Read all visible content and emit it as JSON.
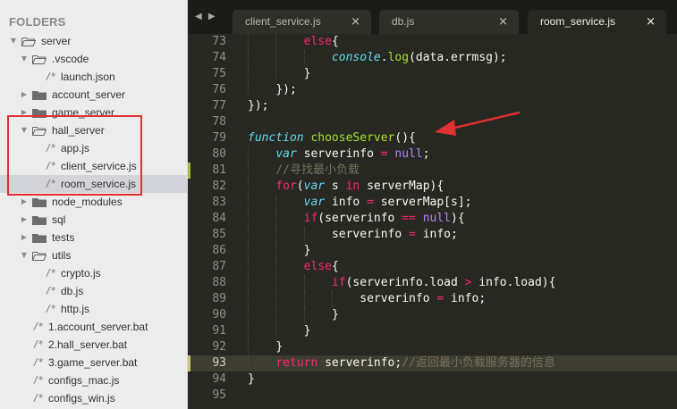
{
  "sidebar": {
    "header": "FOLDERS",
    "items": [
      {
        "label": "server",
        "kind": "folder",
        "open": true,
        "depth": 0
      },
      {
        "label": ".vscode",
        "kind": "folder",
        "open": true,
        "depth": 1
      },
      {
        "label": "launch.json",
        "kind": "file",
        "depth": 2
      },
      {
        "label": "account_server",
        "kind": "folder",
        "open": false,
        "depth": 1
      },
      {
        "label": "game_server",
        "kind": "folder",
        "open": false,
        "depth": 1
      },
      {
        "label": "hall_server",
        "kind": "folder",
        "open": true,
        "depth": 1
      },
      {
        "label": "app.js",
        "kind": "file",
        "depth": 2
      },
      {
        "label": "client_service.js",
        "kind": "file",
        "depth": 2
      },
      {
        "label": "room_service.js",
        "kind": "file",
        "depth": 2,
        "selected": true
      },
      {
        "label": "node_modules",
        "kind": "folder",
        "open": false,
        "depth": 1
      },
      {
        "label": "sql",
        "kind": "folder",
        "open": false,
        "depth": 1
      },
      {
        "label": "tests",
        "kind": "folder",
        "open": false,
        "depth": 1
      },
      {
        "label": "utils",
        "kind": "folder",
        "open": true,
        "depth": 1
      },
      {
        "label": "crypto.js",
        "kind": "file",
        "depth": 2
      },
      {
        "label": "db.js",
        "kind": "file",
        "depth": 2
      },
      {
        "label": "http.js",
        "kind": "file",
        "depth": 2
      },
      {
        "label": "1.account_server.bat",
        "kind": "file",
        "depth": 1
      },
      {
        "label": "2.hall_server.bat",
        "kind": "file",
        "depth": 1
      },
      {
        "label": "3.game_server.bat",
        "kind": "file",
        "depth": 1
      },
      {
        "label": "configs_mac.js",
        "kind": "file",
        "depth": 1
      },
      {
        "label": "configs_win.js",
        "kind": "file",
        "depth": 1
      }
    ],
    "file_glyph": "/*"
  },
  "tabbar": {
    "nav_glyph": "◀ ▶",
    "tabs": [
      {
        "label": "client_service.js",
        "active": false
      },
      {
        "label": "db.js",
        "active": false
      },
      {
        "label": "room_service.js",
        "active": true
      }
    ],
    "close_glyph": "×"
  },
  "editor": {
    "lines": [
      {
        "n": "73",
        "indent": 2,
        "tokens": [
          [
            "kw",
            "else"
          ],
          [
            "pl",
            "{"
          ]
        ]
      },
      {
        "n": "74",
        "indent": 3,
        "tokens": [
          [
            "st",
            "console"
          ],
          [
            "pl",
            "."
          ],
          [
            "fn",
            "log"
          ],
          [
            "pl",
            "(data.errmsg);"
          ]
        ]
      },
      {
        "n": "75",
        "indent": 2,
        "tokens": [
          [
            "pl",
            "}"
          ]
        ]
      },
      {
        "n": "76",
        "indent": 1,
        "tokens": [
          [
            "pl",
            "});"
          ]
        ]
      },
      {
        "n": "77",
        "indent": 0,
        "tokens": [
          [
            "pl",
            "});"
          ]
        ]
      },
      {
        "n": "78",
        "indent": 0,
        "tokens": []
      },
      {
        "n": "79",
        "indent": 0,
        "tokens": [
          [
            "st",
            "function"
          ],
          [
            "pl",
            " "
          ],
          [
            "fn",
            "chooseServer"
          ],
          [
            "pl",
            "(){"
          ]
        ]
      },
      {
        "n": "80",
        "indent": 1,
        "tokens": [
          [
            "st",
            "var"
          ],
          [
            "pl",
            " serverinfo "
          ],
          [
            "kw",
            "="
          ],
          [
            "pl",
            " "
          ],
          [
            "num",
            "null"
          ],
          [
            "pl",
            ";"
          ]
        ]
      },
      {
        "n": "81",
        "indent": 1,
        "tokens": [
          [
            "cm",
            "//寻找最小负载"
          ]
        ]
      },
      {
        "n": "82",
        "indent": 1,
        "tokens": [
          [
            "kw",
            "for"
          ],
          [
            "pl",
            "("
          ],
          [
            "st",
            "var"
          ],
          [
            "pl",
            " s "
          ],
          [
            "kw",
            "in"
          ],
          [
            "pl",
            " serverMap){"
          ]
        ]
      },
      {
        "n": "83",
        "indent": 2,
        "tokens": [
          [
            "st",
            "var"
          ],
          [
            "pl",
            " info "
          ],
          [
            "kw",
            "="
          ],
          [
            "pl",
            " serverMap[s];"
          ]
        ]
      },
      {
        "n": "84",
        "indent": 2,
        "tokens": [
          [
            "kw",
            "if"
          ],
          [
            "pl",
            "(serverinfo "
          ],
          [
            "kw",
            "=="
          ],
          [
            "pl",
            " "
          ],
          [
            "num",
            "null"
          ],
          [
            "pl",
            "){"
          ]
        ]
      },
      {
        "n": "85",
        "indent": 3,
        "tokens": [
          [
            "pl",
            "serverinfo "
          ],
          [
            "kw",
            "="
          ],
          [
            "pl",
            " info;"
          ]
        ]
      },
      {
        "n": "86",
        "indent": 2,
        "tokens": [
          [
            "pl",
            "}"
          ]
        ]
      },
      {
        "n": "87",
        "indent": 2,
        "tokens": [
          [
            "kw",
            "else"
          ],
          [
            "pl",
            "{"
          ]
        ]
      },
      {
        "n": "88",
        "indent": 3,
        "tokens": [
          [
            "kw",
            "if"
          ],
          [
            "pl",
            "(serverinfo.load "
          ],
          [
            "kw",
            ">"
          ],
          [
            "pl",
            " info.load){"
          ]
        ]
      },
      {
        "n": "89",
        "indent": 4,
        "tokens": [
          [
            "pl",
            "serverinfo "
          ],
          [
            "kw",
            "="
          ],
          [
            "pl",
            " info;"
          ]
        ]
      },
      {
        "n": "90",
        "indent": 3,
        "tokens": [
          [
            "pl",
            "}"
          ]
        ]
      },
      {
        "n": "91",
        "indent": 2,
        "tokens": [
          [
            "pl",
            "}"
          ]
        ]
      },
      {
        "n": "92",
        "indent": 1,
        "tokens": [
          [
            "pl",
            "}"
          ]
        ]
      },
      {
        "n": "93",
        "indent": 1,
        "tokens": [
          [
            "kw",
            "return"
          ],
          [
            "pl",
            " serverinfo;"
          ],
          [
            "cm",
            "//返回最小负载服务器的信息"
          ]
        ]
      },
      {
        "n": "94",
        "indent": 0,
        "tokens": [
          [
            "pl",
            "}"
          ]
        ]
      },
      {
        "n": "95",
        "indent": 0,
        "tokens": []
      }
    ]
  },
  "colors": {
    "annotation_red": "#e0302f",
    "editor_bg": "#272822",
    "sidebar_bg": "#ececec"
  }
}
